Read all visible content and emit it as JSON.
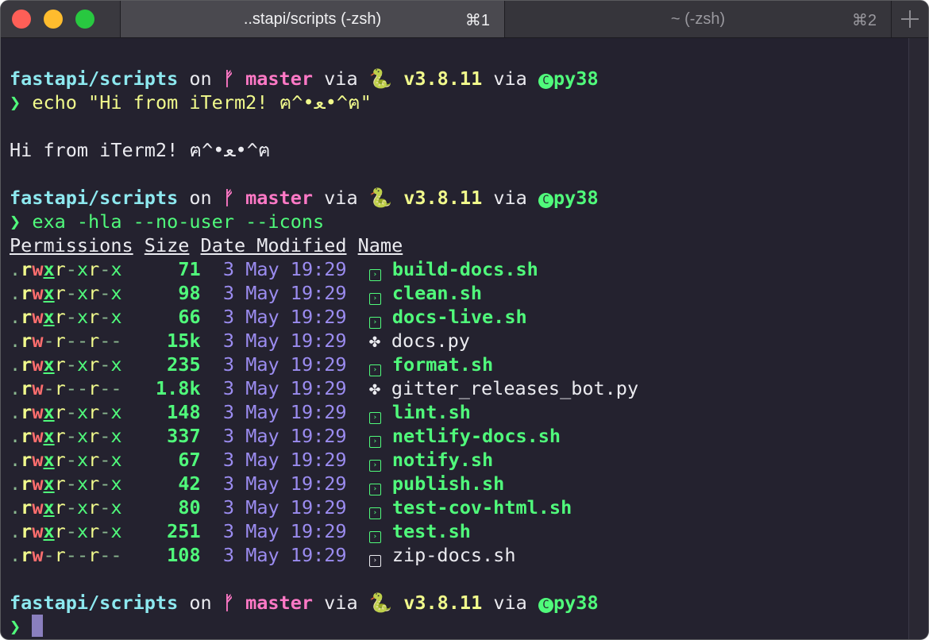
{
  "window": {
    "tabs": [
      {
        "label": "..stapi/scripts (-zsh)",
        "shortcut": "⌘1",
        "active": true
      },
      {
        "label": "~ (-zsh)",
        "shortcut": "⌘2",
        "active": false
      }
    ],
    "new_tab_label": "+"
  },
  "prompt": {
    "dir": "fastapi/scripts",
    "on": "on",
    "branch_icon": "git-branch-icon",
    "branch": "master",
    "via": "via",
    "snake": "🐍",
    "python_version": "v3.8.11",
    "env_icon": "conda-icon",
    "env": "py38",
    "symbol": "❯"
  },
  "commands": {
    "echo": "echo \"Hi from iTerm2! ฅ^•ﻌ•^ฅ\"",
    "echo_output": "Hi from iTerm2! ฅ^•ﻌ•^ฅ",
    "exa": "exa -hla --no-user --icons"
  },
  "headers": {
    "permissions": "Permissions",
    "size": "Size",
    "date": "Date Modified",
    "name": "Name"
  },
  "files": [
    {
      "perm_type": ".",
      "perm": [
        "r",
        "w",
        "x",
        "r",
        "-",
        "x",
        "r",
        "-",
        "x"
      ],
      "size": "71",
      "date": "3 May 19:29",
      "name": "build-docs.sh",
      "kind": "exec"
    },
    {
      "perm_type": ".",
      "perm": [
        "r",
        "w",
        "x",
        "r",
        "-",
        "x",
        "r",
        "-",
        "x"
      ],
      "size": "98",
      "date": "3 May 19:29",
      "name": "clean.sh",
      "kind": "exec"
    },
    {
      "perm_type": ".",
      "perm": [
        "r",
        "w",
        "x",
        "r",
        "-",
        "x",
        "r",
        "-",
        "x"
      ],
      "size": "66",
      "date": "3 May 19:29",
      "name": "docs-live.sh",
      "kind": "exec"
    },
    {
      "perm_type": ".",
      "perm": [
        "r",
        "w",
        "-",
        "r",
        "-",
        "-",
        "r",
        "-",
        "-"
      ],
      "size": "15k",
      "date": "3 May 19:29",
      "name": "docs.py",
      "kind": "python"
    },
    {
      "perm_type": ".",
      "perm": [
        "r",
        "w",
        "x",
        "r",
        "-",
        "x",
        "r",
        "-",
        "x"
      ],
      "size": "235",
      "date": "3 May 19:29",
      "name": "format.sh",
      "kind": "exec"
    },
    {
      "perm_type": ".",
      "perm": [
        "r",
        "w",
        "-",
        "r",
        "-",
        "-",
        "r",
        "-",
        "-"
      ],
      "size": "1.8k",
      "date": "3 May 19:29",
      "name": "gitter_releases_bot.py",
      "kind": "python"
    },
    {
      "perm_type": ".",
      "perm": [
        "r",
        "w",
        "x",
        "r",
        "-",
        "x",
        "r",
        "-",
        "x"
      ],
      "size": "148",
      "date": "3 May 19:29",
      "name": "lint.sh",
      "kind": "exec"
    },
    {
      "perm_type": ".",
      "perm": [
        "r",
        "w",
        "x",
        "r",
        "-",
        "x",
        "r",
        "-",
        "x"
      ],
      "size": "337",
      "date": "3 May 19:29",
      "name": "netlify-docs.sh",
      "kind": "exec"
    },
    {
      "perm_type": ".",
      "perm": [
        "r",
        "w",
        "x",
        "r",
        "-",
        "x",
        "r",
        "-",
        "x"
      ],
      "size": "67",
      "date": "3 May 19:29",
      "name": "notify.sh",
      "kind": "exec"
    },
    {
      "perm_type": ".",
      "perm": [
        "r",
        "w",
        "x",
        "r",
        "-",
        "x",
        "r",
        "-",
        "x"
      ],
      "size": "42",
      "date": "3 May 19:29",
      "name": "publish.sh",
      "kind": "exec"
    },
    {
      "perm_type": ".",
      "perm": [
        "r",
        "w",
        "x",
        "r",
        "-",
        "x",
        "r",
        "-",
        "x"
      ],
      "size": "80",
      "date": "3 May 19:29",
      "name": "test-cov-html.sh",
      "kind": "exec"
    },
    {
      "perm_type": ".",
      "perm": [
        "r",
        "w",
        "x",
        "r",
        "-",
        "x",
        "r",
        "-",
        "x"
      ],
      "size": "251",
      "date": "3 May 19:29",
      "name": "test.sh",
      "kind": "exec"
    },
    {
      "perm_type": ".",
      "perm": [
        "r",
        "w",
        "-",
        "r",
        "-",
        "-",
        "r",
        "-",
        "-"
      ],
      "size": "108",
      "date": "3 May 19:29",
      "name": "zip-docs.sh",
      "kind": "script"
    }
  ],
  "colors": {
    "background": "#24222f",
    "dir": "#8de8ef",
    "branch": "#ff79c6",
    "version": "#f1fa8c",
    "green": "#50fa7b",
    "date": "#9b8cf0",
    "cursor": "#8a7fbe"
  }
}
